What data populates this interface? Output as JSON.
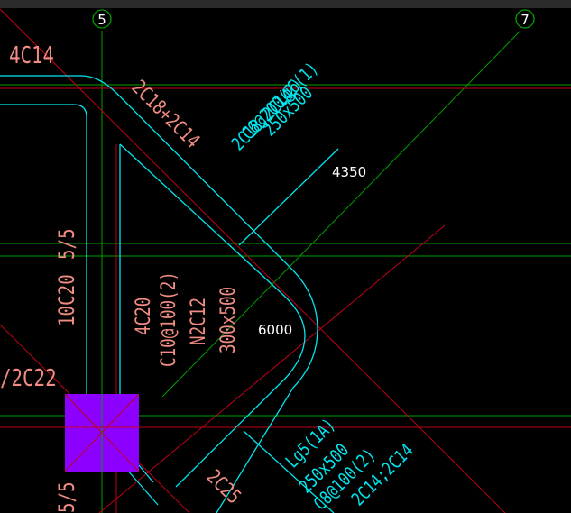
{
  "grid_axes": [
    {
      "id": "axis-5",
      "label": "5"
    },
    {
      "id": "axis-7",
      "label": "7"
    }
  ],
  "red_labels": {
    "top_left_bars": "4C14",
    "top_beam_bars": "2C18+2C14",
    "column_note_1": "10C20",
    "column_note_2": "5/5",
    "beam_4c20": "4C20",
    "beam_stirrup": "C10@100(2)",
    "beam_waist": "N2C12",
    "beam_size": "300x500",
    "left_bottom_bars": "/2C22",
    "bottom_left_ratio": "5/5",
    "bottom_bars": "2C25"
  },
  "beam_lg6": {
    "name": "Lg6(1)",
    "size": "250x500",
    "stirrup": "C6@200(2)",
    "bars": "2C18;2C14"
  },
  "beam_lg5": {
    "name": "Lg5(1A)",
    "size": "250x500",
    "stirrup": "C8@100(2)",
    "bars": "2C14;2C14"
  },
  "dimensions": {
    "span_upper": "4350",
    "span_middle": "6000"
  },
  "colors": {
    "background": "#000000",
    "cyan": "#00e5ee",
    "red_line": "#c0001a",
    "green_line": "#00a000",
    "salmon_text": "#f08c82",
    "column_fill": "#8c00ff",
    "white": "#ffffff"
  }
}
